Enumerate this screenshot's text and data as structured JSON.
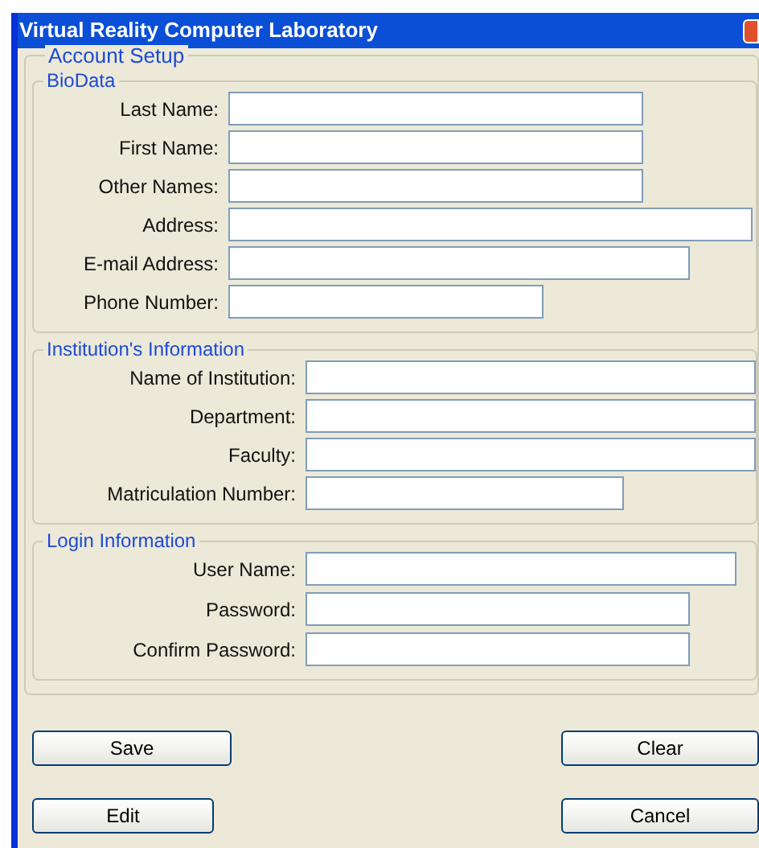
{
  "window": {
    "title": "Virtual Reality Computer Laboratory"
  },
  "account_setup": {
    "title": "Account Setup",
    "groups": [
      {
        "title": "BioData",
        "fields": [
          {
            "label": "Last Name:"
          },
          {
            "label": "First Name:"
          },
          {
            "label": "Other Names:"
          },
          {
            "label": "Address:"
          },
          {
            "label": "E-mail Address:"
          },
          {
            "label": "Phone Number:"
          }
        ]
      },
      {
        "title": "Institution's Information",
        "fields": [
          {
            "label": "Name of Institution:"
          },
          {
            "label": "Department:"
          },
          {
            "label": "Faculty:"
          },
          {
            "label": "Matriculation Number:"
          }
        ]
      },
      {
        "title": "Login Information",
        "fields": [
          {
            "label": "User Name:"
          },
          {
            "label": "Password:"
          },
          {
            "label": "Confirm Password:"
          }
        ]
      }
    ]
  },
  "buttons": [
    {
      "label": "Save"
    },
    {
      "label": "Clear"
    },
    {
      "label": "Edit"
    },
    {
      "label": "Cancel"
    }
  ]
}
